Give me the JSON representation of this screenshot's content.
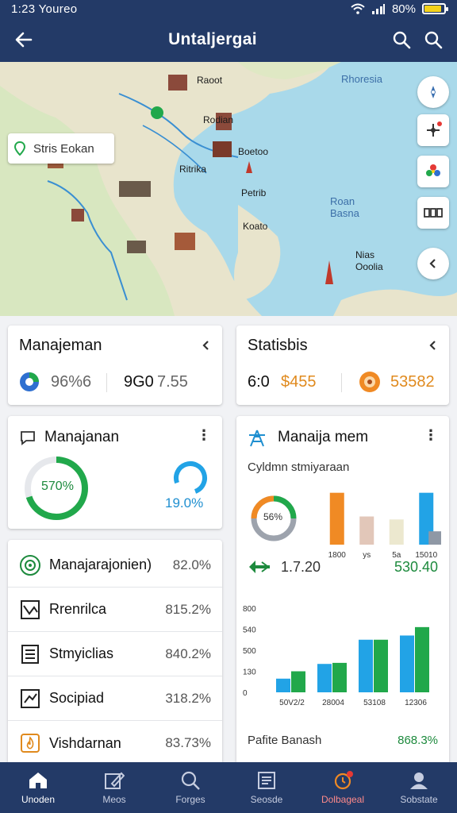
{
  "status_bar": {
    "time": "1:23 Youreo",
    "battery": "80%"
  },
  "app_bar": {
    "title": "Untaljergai"
  },
  "map": {
    "search_label": "Stris Eokan",
    "labels": [
      "Raoot",
      "Rhoresia",
      "Rodian",
      "Boetoo",
      "Ritrika",
      "Petrib",
      "Koato",
      "Roan Basna",
      "Nias Ooolia"
    ]
  },
  "card_stat_left": {
    "title": "Manajeman",
    "value1": "96%6",
    "value2": "9G0",
    "value3": "7.55"
  },
  "card_stat_right": {
    "title": "Statisbis",
    "value1": "6:0",
    "value2": "$455",
    "value3": "53582"
  },
  "card_gauge": {
    "title": "Manajanan",
    "donut_label": "570%",
    "ring_label": "19.0%",
    "donut_fraction": 0.7,
    "ring_fraction": 0.75,
    "colors": {
      "green": "#21a84b",
      "blue": "#22a3e6"
    }
  },
  "list": [
    {
      "label": "Manajarajonien)",
      "value": "82.0%",
      "icon": "target-icon"
    },
    {
      "label": "Rrenrilca",
      "value": "815.2%",
      "icon": "chart-icon"
    },
    {
      "label": "Stmyiclias",
      "value": "840.2%",
      "icon": "document-icon"
    },
    {
      "label": "Socipiad",
      "value": "318.2%",
      "icon": "trend-icon"
    },
    {
      "label": "Vishdarnan",
      "value": "83.73%",
      "icon": "flame-icon"
    }
  ],
  "card_chart": {
    "title": "Manaija mem",
    "subtitle": "Cyldmn stmiyaraan",
    "donut_label": "56%",
    "trend_value": "1.7.20",
    "trend_value_right": "530.40",
    "footer_label": "Pafite Banash",
    "footer_value": "868.3%"
  },
  "chart_data": [
    {
      "type": "bar",
      "categories": [
        "1800",
        "ys",
        "5a",
        "15010"
      ],
      "series": [
        {
          "values": [
            70,
            38,
            34,
            70
          ],
          "color": "#f08a24"
        }
      ],
      "colors": [
        "#f08a24",
        "#e2c7b9",
        "#ece8cf",
        "#22a3e6"
      ],
      "extra_bar": {
        "value": 18,
        "color": "#8f98a5"
      },
      "ylim": [
        0,
        75
      ]
    },
    {
      "type": "bar",
      "categories": [
        "50V2/2",
        "28004",
        "53108",
        "12306"
      ],
      "y_ticks": [
        "800",
        "540",
        "500",
        "130",
        "0"
      ],
      "series": [
        {
          "values": [
            130,
            270,
            500,
            540
          ],
          "color": "#22a3e6"
        },
        {
          "values": [
            200,
            280,
            500,
            620
          ],
          "color": "#21a84b"
        }
      ],
      "ylim": [
        0,
        800
      ]
    }
  ],
  "bottom_nav": [
    {
      "label": "Unoden",
      "icon": "home-icon",
      "active": true
    },
    {
      "label": "Meos",
      "icon": "edit-icon",
      "active": false
    },
    {
      "label": "Forges",
      "icon": "search-icon",
      "active": false
    },
    {
      "label": "Seosde",
      "icon": "list-icon",
      "active": false
    },
    {
      "label": "Dolbageal",
      "icon": "clock-icon",
      "active": false,
      "alert": true
    },
    {
      "label": "Sobstate",
      "icon": "user-icon",
      "active": false
    }
  ]
}
